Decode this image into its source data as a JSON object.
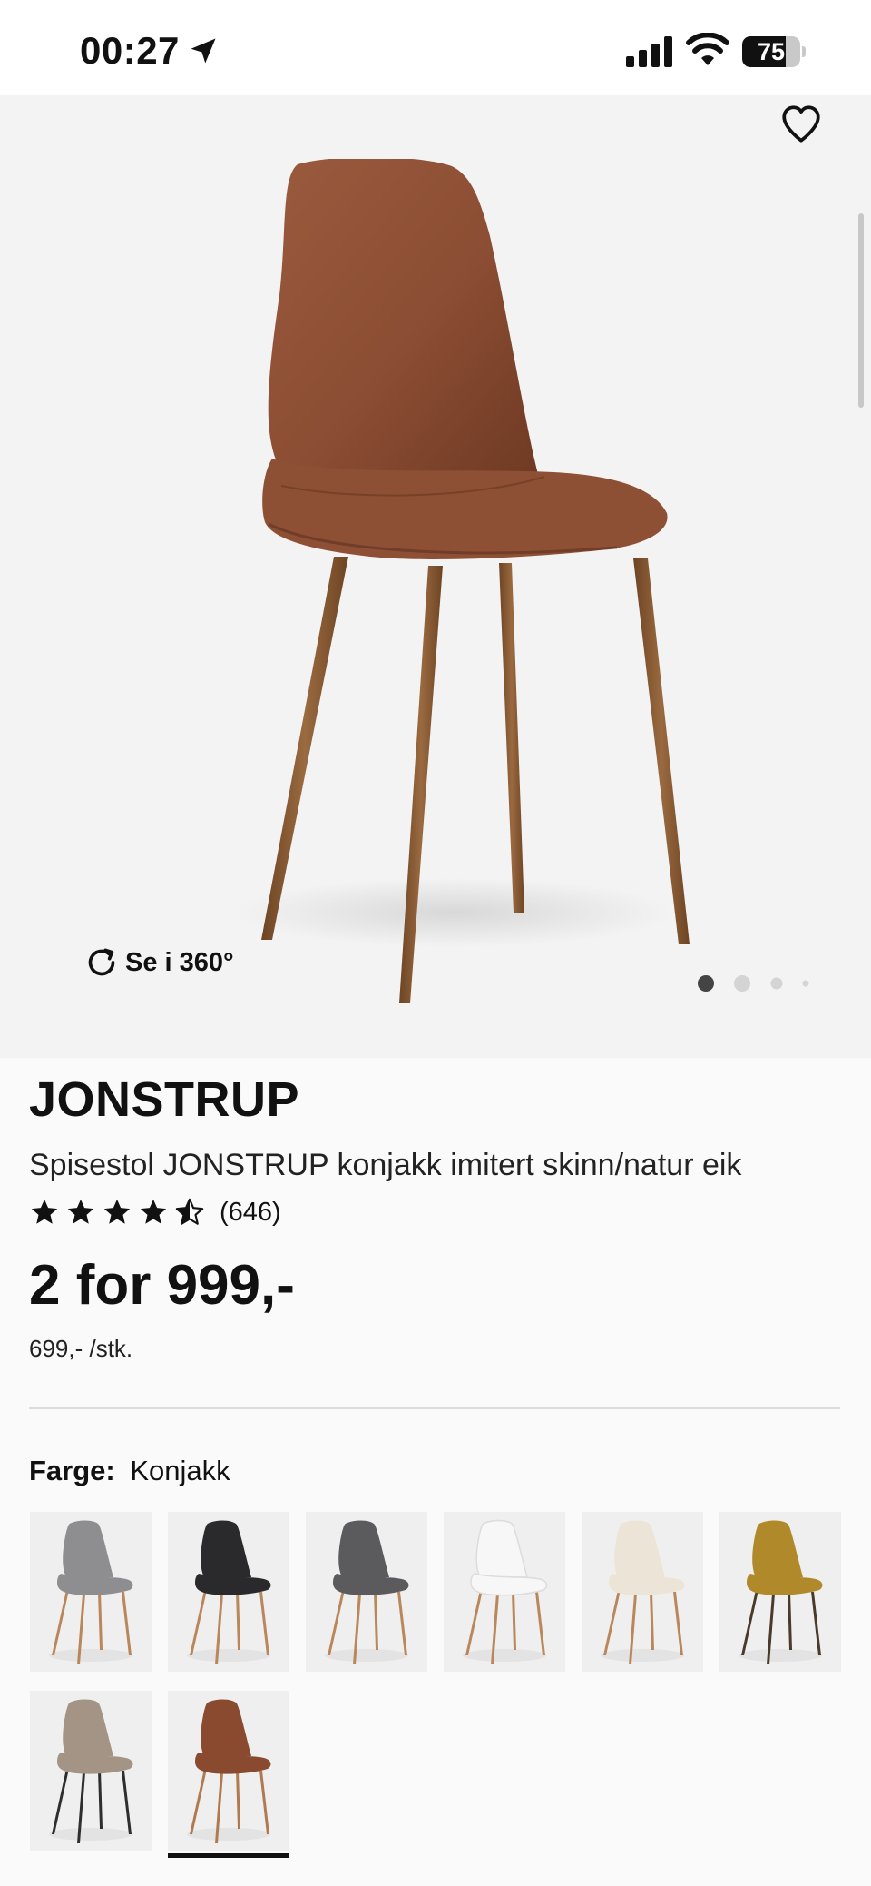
{
  "status_bar": {
    "time": "00:27",
    "battery_level": 75,
    "battery_label": "75"
  },
  "gallery": {
    "spin_label": "Se i 360°",
    "image_count": 4,
    "active_image": 1
  },
  "product": {
    "title": "JONSTRUP",
    "subtitle": "Spisestol JONSTRUP konjakk imitert skinn/natur eik",
    "rating": 4.5,
    "review_count": "(646)",
    "price": "2 for 999,-",
    "unit_price": "699,- /stk."
  },
  "color_picker": {
    "label": "Farge:",
    "selected": "Konjakk",
    "swatches": [
      {
        "name": "grey",
        "seat": "#8e8e90",
        "legs": "#b9875a"
      },
      {
        "name": "black",
        "seat": "#2a2a2c",
        "legs": "#b9875a"
      },
      {
        "name": "dark-grey",
        "seat": "#5b5b5e",
        "legs": "#b9875a"
      },
      {
        "name": "white",
        "seat": "#f7f7f7",
        "legs": "#b9875a"
      },
      {
        "name": "sheepskin",
        "seat": "#ece4d6",
        "legs": "#b9875a"
      },
      {
        "name": "mustard",
        "seat": "#b08a2a",
        "legs": "#4a3a2a"
      },
      {
        "name": "taupe",
        "seat": "#a39485",
        "legs": "#2e2e2e"
      },
      {
        "name": "cognac",
        "seat": "#8a4a30",
        "legs": "#b07a4e"
      }
    ]
  },
  "colors": {
    "chair_leather": "#8b4d33",
    "chair_legs": "#8b5a32",
    "accent": "#111111"
  }
}
